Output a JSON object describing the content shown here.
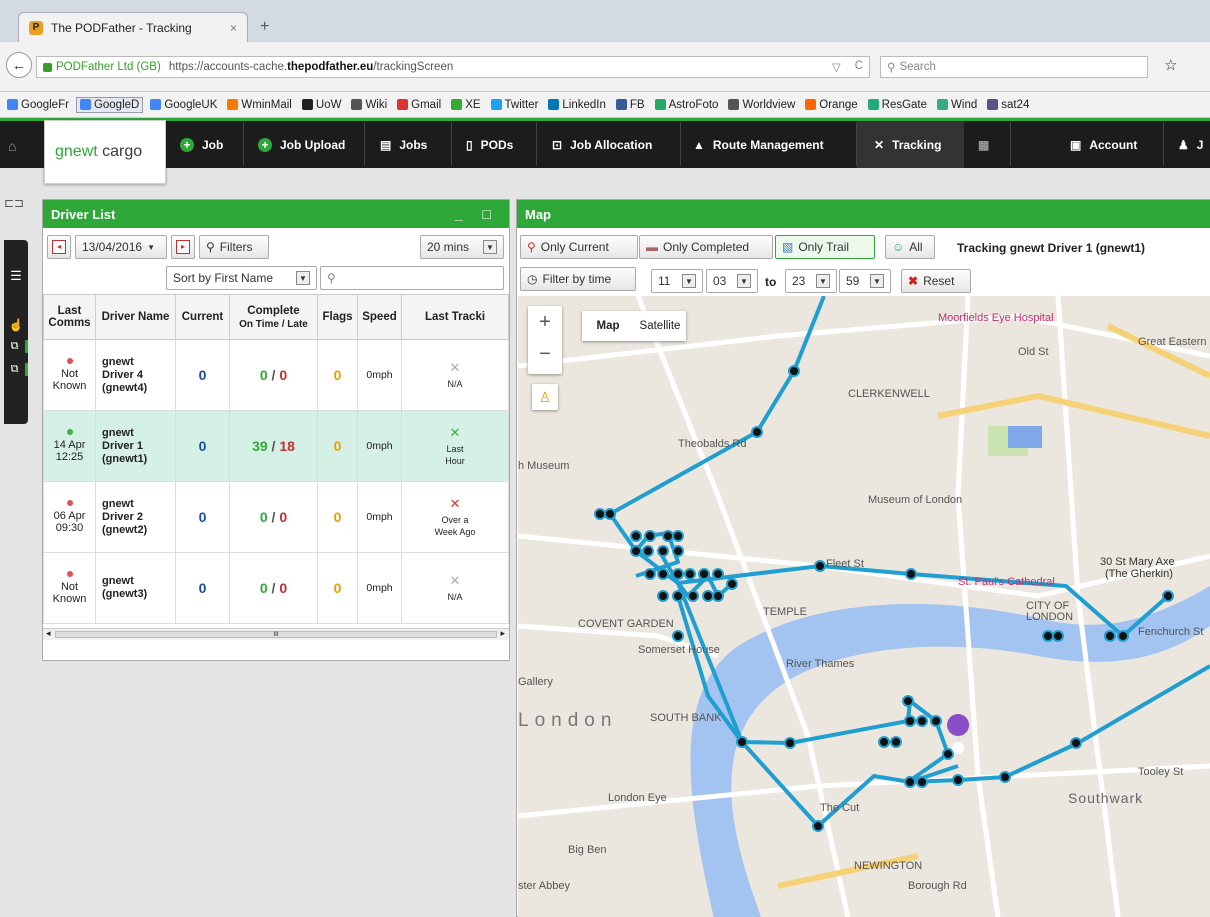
{
  "browser": {
    "tab_title": "The PODFather - Tracking",
    "tab_close": "×",
    "new_tab": "+",
    "url_identity": "PODFather Ltd (GB)",
    "url_prefix": "https://accounts-cache.",
    "url_domain": "thepodfather.eu",
    "url_path": "/trackingScreen",
    "search_placeholder": "Search",
    "bookmarks": [
      "GoogleFr",
      "GoogleD",
      "GoogleUK",
      "WminMail",
      "UoW",
      "Wiki",
      "Gmail",
      "XE",
      "Twitter",
      "LinkedIn",
      "FB",
      "AstroFoto",
      "Worldview",
      "Orange",
      "ResGate",
      "Wind",
      "sat24"
    ]
  },
  "nav": {
    "logo_brand": "gnewt",
    "logo_rest": " cargo",
    "items": [
      "Job",
      "Job Upload",
      "Jobs",
      "PODs",
      "Job Allocation",
      "Route Management",
      "Tracking"
    ],
    "account": "Account",
    "user_initial": "J"
  },
  "driver_list": {
    "title": "Driver List",
    "date": "13/04/2016",
    "filters_label": "Filters",
    "interval": "20 mins",
    "sort_label": "Sort by First Name",
    "columns": {
      "last_comms": "Last Comms",
      "driver_name": "Driver Name",
      "current": "Current",
      "complete": "Complete",
      "complete_sub": "On Time / Late",
      "flags": "Flags",
      "speed": "Speed",
      "last_tracking": "Last Tracki"
    },
    "rows": [
      {
        "comms_line1": "Not",
        "comms_line2": "Known",
        "status_color": "#e45050",
        "name1": "gnewt",
        "name2": "Driver 4",
        "name3": "(gnewt4)",
        "current": "0",
        "on_time": "0",
        "late": "0",
        "flags": "0",
        "speed": "0mph",
        "track_line1": "N/A",
        "track_line2": ""
      },
      {
        "comms_line1": "14 Apr",
        "comms_line2": "12:25",
        "status_color": "#3cb044",
        "name1": "gnewt",
        "name2": "Driver 1",
        "name3": "(gnewt1)",
        "current": "0",
        "on_time": "39",
        "late": "18",
        "flags": "0",
        "speed": "0mph",
        "track_line1": "Last",
        "track_line2": "Hour"
      },
      {
        "comms_line1": "06 Apr",
        "comms_line2": "09:30",
        "status_color": "#e45050",
        "name1": "gnewt",
        "name2": "Driver 2",
        "name3": "(gnewt2)",
        "current": "0",
        "on_time": "0",
        "late": "0",
        "flags": "0",
        "speed": "0mph",
        "track_line1": "Over a",
        "track_line2": "Week Ago"
      },
      {
        "comms_line1": "Not",
        "comms_line2": "Known",
        "status_color": "#e45050",
        "name1": "gnewt",
        "name2": "(gnewt3)",
        "name3": "",
        "current": "0",
        "on_time": "0",
        "late": "0",
        "flags": "0",
        "speed": "0mph",
        "track_line1": "N/A",
        "track_line2": ""
      }
    ],
    "scroll_grip": "III"
  },
  "map": {
    "title": "Map",
    "only_current": "Only Current",
    "only_completed": "Only Completed",
    "only_trail": "Only Trail",
    "all": "All",
    "tracking_title": "Tracking gnewt Driver 1 (gnewt1)",
    "filter_time": "Filter by time",
    "from_h": "11",
    "from_m": "03",
    "to_label": "to",
    "to_h": "23",
    "to_m": "59",
    "reset": "Reset",
    "map_btn": "Map",
    "satellite_btn": "Satellite",
    "labels": [
      "Moorfields Eye Hospital",
      "CLERKENWELL",
      "Museum of London",
      "30 St Mary Axe",
      "(The Gherkin)",
      "St. Paul's Cathedral",
      "CITY OF",
      "LONDON",
      "TEMPLE",
      "COVENT GARDEN",
      "Somerset House",
      "River Thames",
      "London",
      "SOUTH BANK",
      "London Eye",
      "Big Ben",
      "Southwark",
      "NEWINGTON",
      "Borough Rd",
      "Gallery",
      "h Museum",
      "Theobalds Rd",
      "Old St",
      "Fleet St",
      "The Cut",
      "Tooley St",
      "Fenchurch St",
      "ster Abbey",
      "Great Eastern St"
    ]
  }
}
